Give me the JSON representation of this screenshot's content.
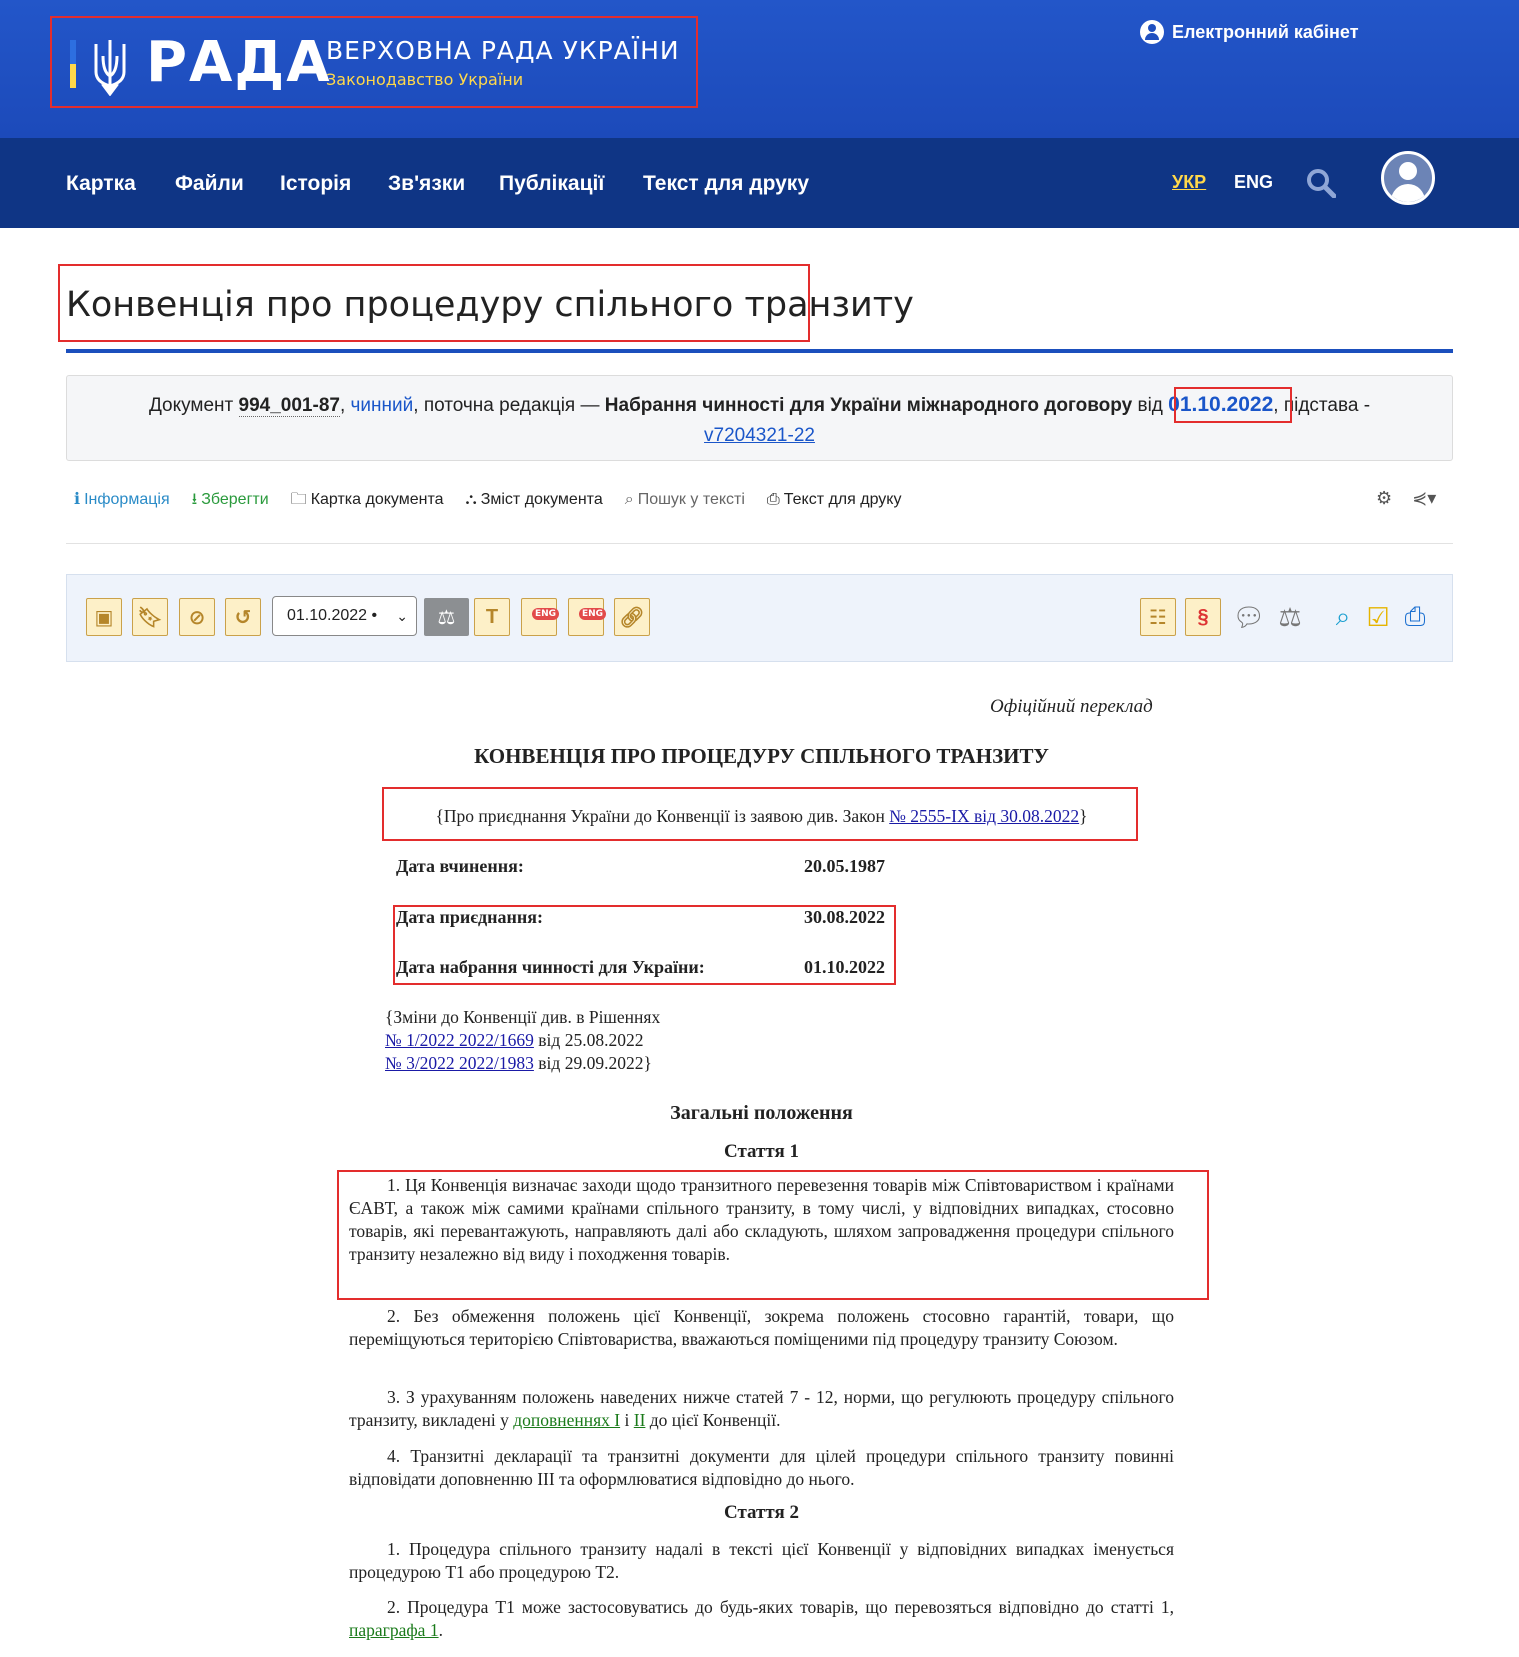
{
  "header": {
    "logo_word": "РАДА",
    "org_name": "ВЕРХОВНА РАДА УКРАЇНИ",
    "org_sub": "Законодавство України",
    "cabinet": "Електронний кабінет"
  },
  "nav": {
    "items": [
      "Картка",
      "Файли",
      "Історія",
      "Зв'язки",
      "Публікації",
      "Текст для друку"
    ],
    "lang_ukr": "УКР",
    "lang_eng": "ENG"
  },
  "page": {
    "title": "Конвенція про процедуру спільного транзиту"
  },
  "status": {
    "prefix": "Документ",
    "doc_number": "994_001-87",
    "sep1": ",",
    "state": "чинний",
    "current": ", поточна редакція —",
    "redaction": "Набрання чинності для України міжнародного договору",
    "from": "від",
    "date": "01.10.2022",
    "basis_label": ", підстава -",
    "basis_link": "v7204321-22"
  },
  "tools": {
    "info": "Інформація",
    "save": "Зберегти",
    "card": "Картка документа",
    "contents": "Зміст документа",
    "search": "Пошук у тексті",
    "print": "Текст для друку"
  },
  "toolbar": {
    "date_value": "01.10.2022 •",
    "eng_badge": "ENG"
  },
  "document": {
    "official": "Офіційний переклад",
    "heading": "КОНВЕНЦІЯ ПРО ПРОЦЕДУРУ СПІЛЬНОГО ТРАНЗИТУ",
    "accession_note_pre": "{Про приєднання України до Конвенції із заявою див. Закон ",
    "accession_note_link": "№ 2555-IX від 30.08.2022",
    "accession_note_post": "}",
    "rows": [
      {
        "label": "Дата вчинення:",
        "value": "20.05.1987"
      },
      {
        "label": "Дата приєднання:",
        "value": "30.08.2022"
      },
      {
        "label": "Дата набрання чинності для України:",
        "value": "01.10.2022"
      }
    ],
    "changes_intro": "{Зміни до Конвенції див. в Рішеннях",
    "change1_link": "№ 1/2022 2022/1669",
    "change1_date": " від 25.08.2022",
    "change2_link": "№ 3/2022 2022/1983",
    "change2_date": " від 29.09.2022}",
    "section_title": "Загальні положення",
    "article1": "Стаття 1",
    "a1_p1": "1. Ця Конвенція визначає заходи щодо транзитного перевезення товарів між Співтовариством і країнами ЄАВТ, а також між самими країнами спільного транзиту, в тому числі, у відповідних випадках, стосовно товарів, які перевантажують, направляють далі або складують, шляхом запровадження процедури спільного транзиту незалежно від виду і походження товарів.",
    "a1_p2": "2. Без обмеження положень цієї Конвенції, зокрема положень стосовно гарантій, товари, що переміщуються територією Співтовариства, вважаються поміщеними під процедуру транзиту Союзом.",
    "a1_p3_pre": "3. З урахуванням положень наведених нижче статей 7 - 12, норми, що регулюють процедуру спільного транзиту, викладені у ",
    "a1_p3_link1": "доповненнях I",
    "a1_p3_mid": " і ",
    "a1_p3_link2": "II",
    "a1_p3_post": " до цієї Конвенції.",
    "a1_p4": "4. Транзитні декларації та транзитні документи для цілей процедури спільного транзиту повинні відповідати доповненню III та оформлюватися відповідно до нього.",
    "article2": "Стаття 2",
    "a2_p1": "1. Процедура спільного транзиту надалі в тексті цієї Конвенції у відповідних випадках іменується процедурою T1 або процедурою T2.",
    "a2_p2_pre": "2. Процедура T1 може застосовуватись до будь-яких товарів, що перевозяться відповідно до статті 1, ",
    "a2_p2_link": "параграфа 1",
    "a2_p2_post": "."
  },
  "colors": {
    "header_blue": "#1f4fbf",
    "nav_blue": "#0f3585",
    "accent_yellow": "#ffd84a",
    "highlight_red": "#e32d2d"
  }
}
